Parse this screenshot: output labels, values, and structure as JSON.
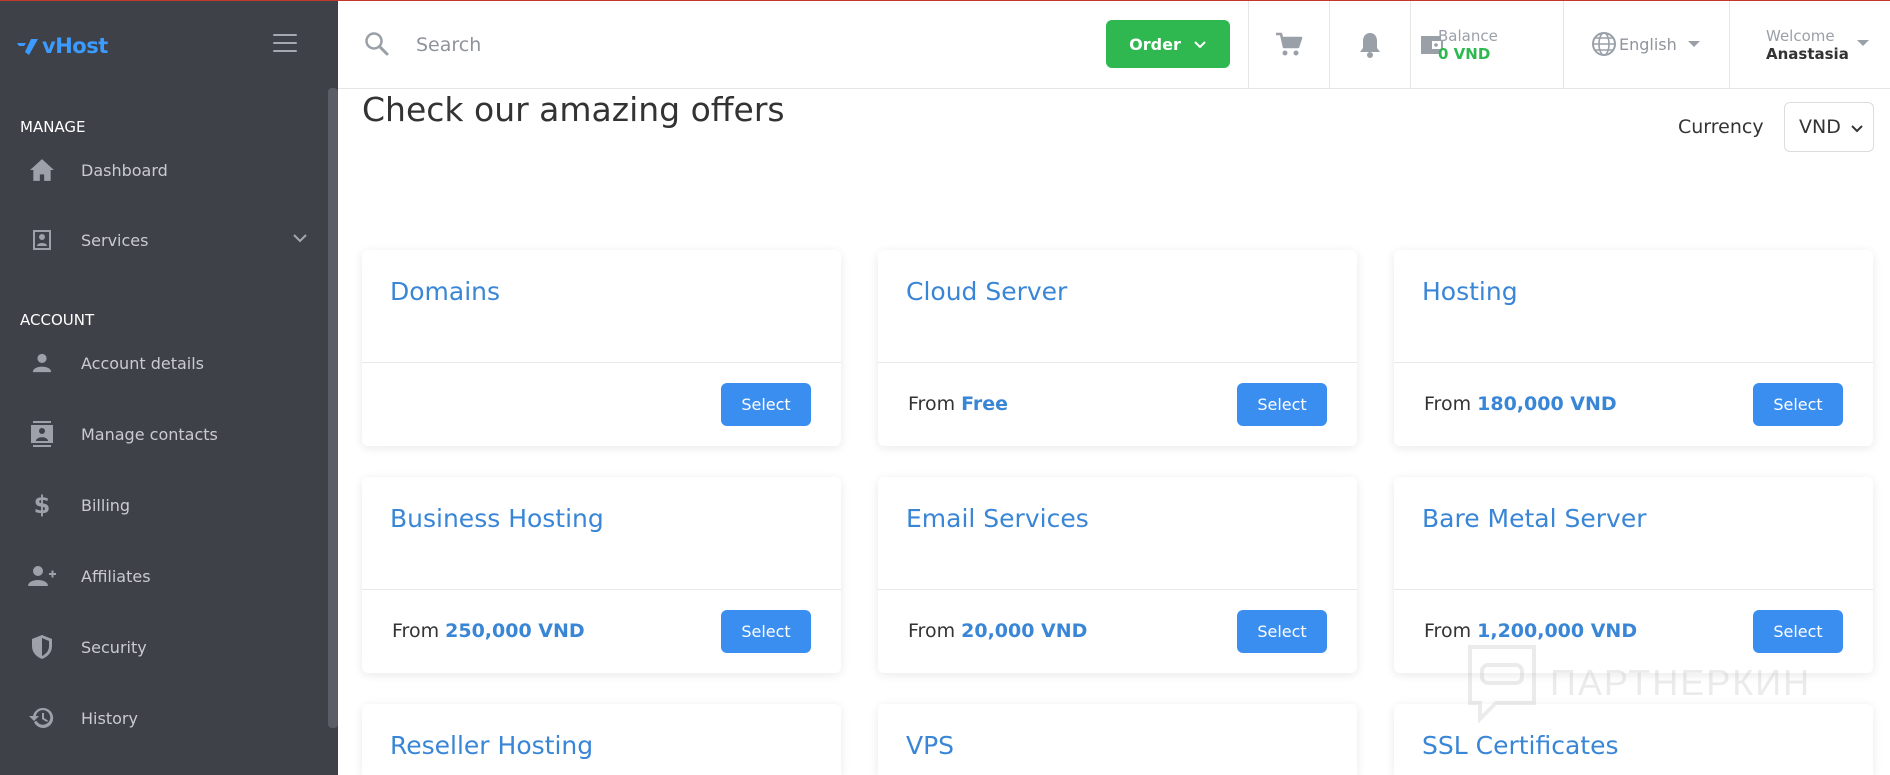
{
  "app": {
    "logo_text": "vHost"
  },
  "sidebar": {
    "sections": [
      {
        "label": "MANAGE"
      },
      {
        "label": "ACCOUNT"
      }
    ],
    "items": [
      {
        "label": "Dashboard",
        "icon": "home-icon"
      },
      {
        "label": "Services",
        "icon": "id-card-icon"
      },
      {
        "label": "Account details",
        "icon": "user-icon"
      },
      {
        "label": "Manage contacts",
        "icon": "contacts-icon"
      },
      {
        "label": "Billing",
        "icon": "dollar-icon"
      },
      {
        "label": "Affiliates",
        "icon": "user-plus-icon"
      },
      {
        "label": "Security",
        "icon": "shield-icon"
      },
      {
        "label": "History",
        "icon": "history-icon"
      }
    ]
  },
  "header": {
    "search_placeholder": "Search",
    "order_label": "Order",
    "balance_label": "Balance",
    "balance_value": "0 VND",
    "language": "English",
    "welcome_label": "Welcome",
    "user_name": "Anastasia"
  },
  "main": {
    "title": "Check our amazing offers",
    "currency_label": "Currency",
    "currency_value": "VND",
    "cards": [
      {
        "title": "Domains",
        "price_prefix": "",
        "price_value": "",
        "button": "Select"
      },
      {
        "title": "Cloud Server",
        "price_prefix": "From ",
        "price_value": "Free",
        "button": "Select"
      },
      {
        "title": "Hosting",
        "price_prefix": "From ",
        "price_value": "180,000 VND",
        "button": "Select"
      },
      {
        "title": "Business Hosting",
        "price_prefix": "From ",
        "price_value": "250,000 VND",
        "button": "Select"
      },
      {
        "title": "Email Services",
        "price_prefix": "From ",
        "price_value": "20,000 VND",
        "button": "Select"
      },
      {
        "title": "Bare Metal Server",
        "price_prefix": "From ",
        "price_value": "1,200,000 VND",
        "button": "Select"
      },
      {
        "title": "Reseller Hosting"
      },
      {
        "title": "VPS"
      },
      {
        "title": "SSL Certificates"
      }
    ]
  },
  "watermark": {
    "text": "ПАРТНЕРКИН"
  },
  "colors": {
    "sidebar_bg": "#3f4149",
    "accent_blue": "#3a8ef0",
    "order_green": "#2eb84f",
    "title_blue": "#3a86d6"
  }
}
